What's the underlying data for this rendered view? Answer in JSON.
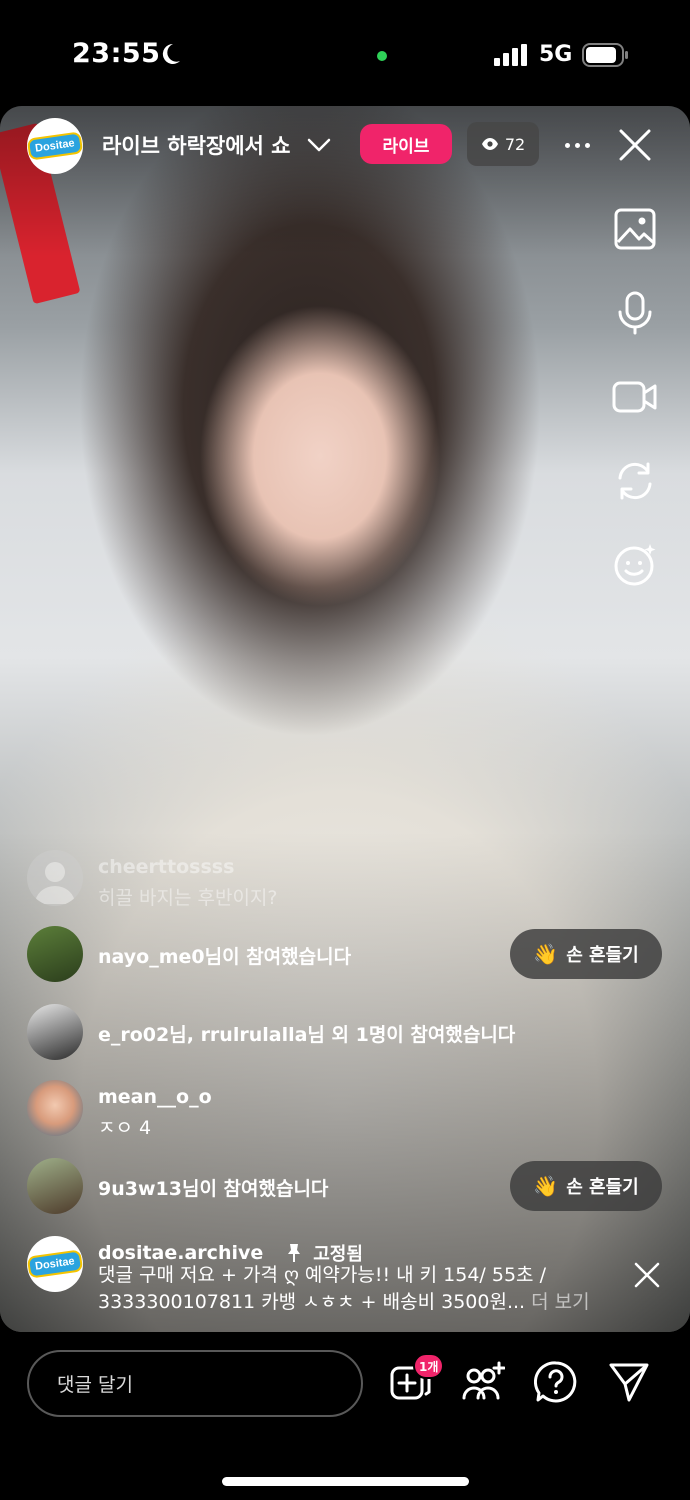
{
  "status_bar": {
    "time": "23:55",
    "network": "5G"
  },
  "header": {
    "host_badge": "Dositae",
    "title": "라이브 하락장에서 쇼",
    "live_label": "라이브",
    "viewer_count": "72"
  },
  "tools": [
    "image-icon",
    "microphone-icon",
    "video-camera-icon",
    "flip-camera-icon",
    "effects-icon"
  ],
  "comments": [
    {
      "user": "cheerttossss",
      "text": "히끌 바지는 후반이지?"
    },
    {
      "join_text": "nayo_me0님이 참여했습니다",
      "wave_label": "손 흔들기"
    },
    {
      "join_text": "e_ro02님, rrulrulalla님 외 1명이 참여했습니다"
    },
    {
      "user": "mean__o_o",
      "text": "ㅈㅇ 4"
    },
    {
      "join_text": "9u3w13님이 참여했습니다",
      "wave_label": "손 흔들기"
    }
  ],
  "pinned": {
    "user": "dositae.archive",
    "label": "고정됨",
    "badge": "Dositae",
    "text": "댓글 구매 저요 + 가격 ღ 예약가능!! 내 키 154/ 55초 / 3333300107811 카뱅 ㅅㅎㅊ + 배송비 3500원...",
    "see_more": "더 보기"
  },
  "bottom_bar": {
    "comment_placeholder": "댓글 달기",
    "request_badge": "1개"
  },
  "colors": {
    "accent": "#f0246a",
    "status_green": "#2fd158",
    "brand_blue": "#2aa3df"
  }
}
